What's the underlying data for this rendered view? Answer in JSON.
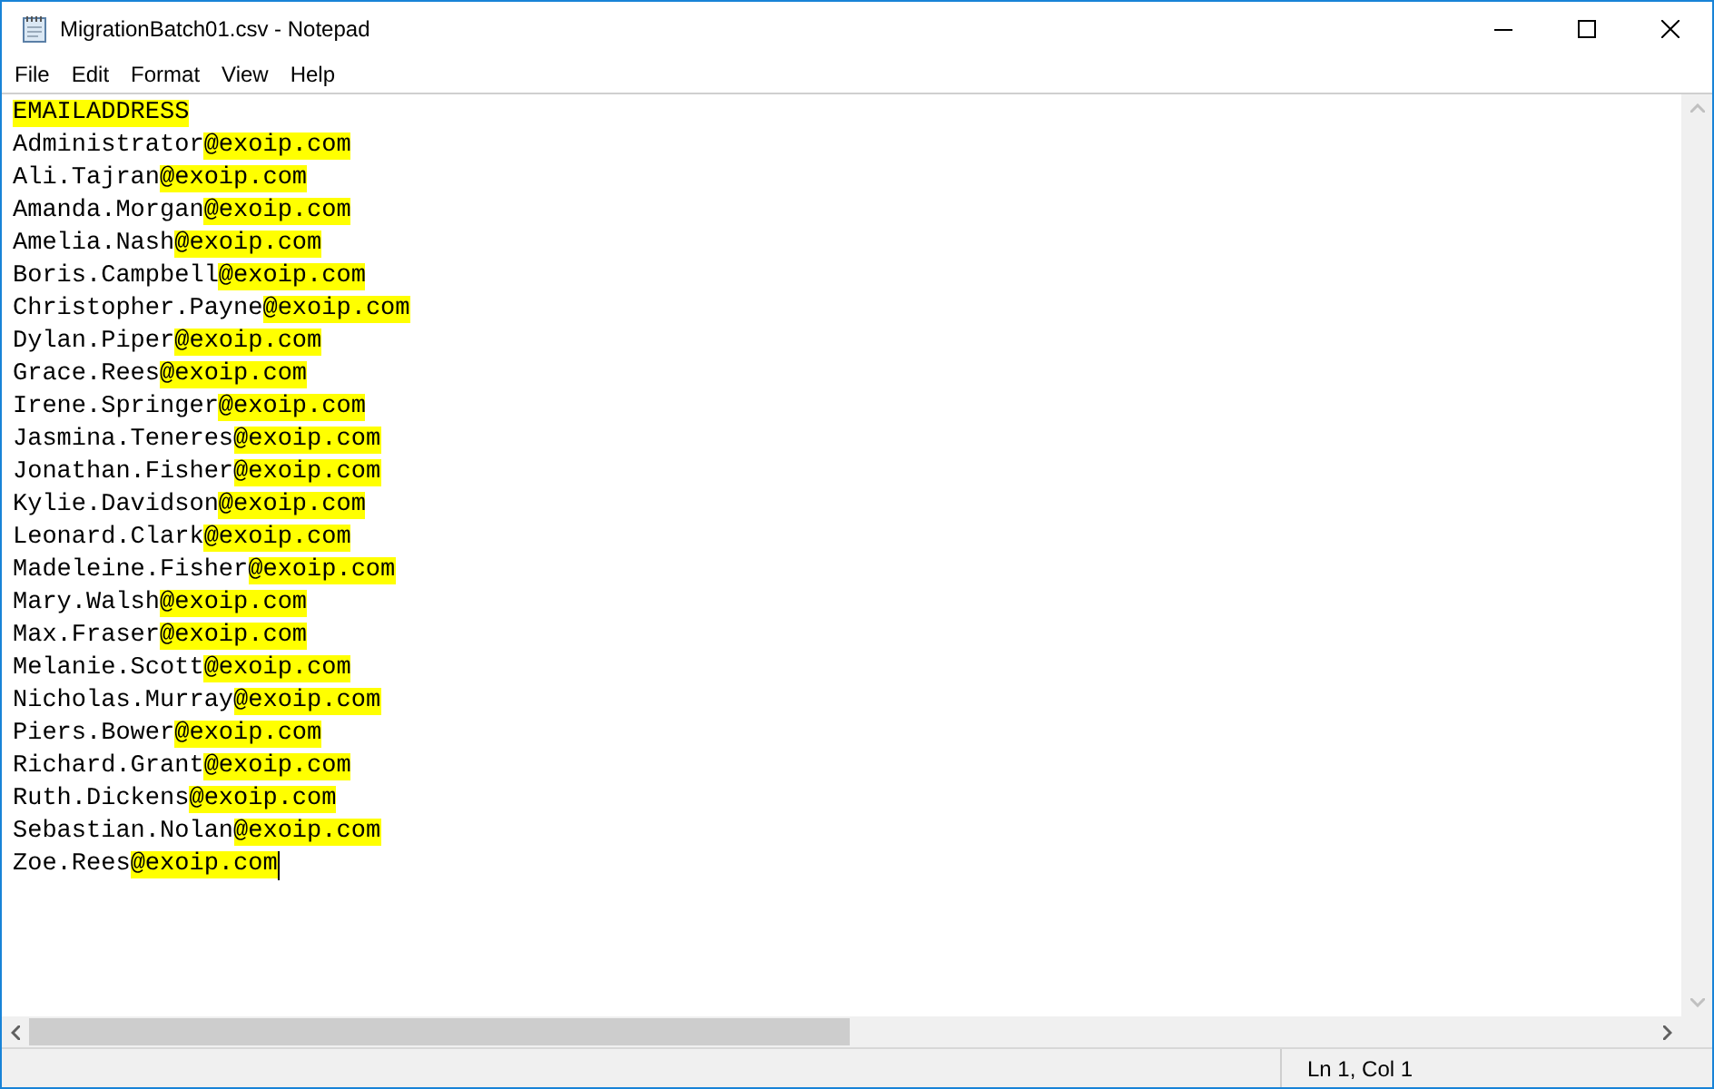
{
  "window": {
    "title": "MigrationBatch01.csv - Notepad"
  },
  "menu": [
    "File",
    "Edit",
    "Format",
    "View",
    "Help"
  ],
  "editor": {
    "lines": [
      {
        "segments": [
          {
            "text": "EMAILADDRESS",
            "highlighted": true
          }
        ]
      },
      {
        "segments": [
          {
            "text": "Administrator",
            "highlighted": false
          },
          {
            "text": "@exoip.com",
            "highlighted": true
          }
        ]
      },
      {
        "segments": [
          {
            "text": "Ali.Tajran",
            "highlighted": false
          },
          {
            "text": "@exoip.com",
            "highlighted": true
          }
        ]
      },
      {
        "segments": [
          {
            "text": "Amanda.Morgan",
            "highlighted": false
          },
          {
            "text": "@exoip.com",
            "highlighted": true
          }
        ]
      },
      {
        "segments": [
          {
            "text": "Amelia.Nash",
            "highlighted": false
          },
          {
            "text": "@exoip.com",
            "highlighted": true
          }
        ]
      },
      {
        "segments": [
          {
            "text": "Boris.Campbell",
            "highlighted": false
          },
          {
            "text": "@exoip.com",
            "highlighted": true
          }
        ]
      },
      {
        "segments": [
          {
            "text": "Christopher.Payne",
            "highlighted": false
          },
          {
            "text": "@exoip.com",
            "highlighted": true
          }
        ]
      },
      {
        "segments": [
          {
            "text": "Dylan.Piper",
            "highlighted": false
          },
          {
            "text": "@exoip.com",
            "highlighted": true
          }
        ]
      },
      {
        "segments": [
          {
            "text": "Grace.Rees",
            "highlighted": false
          },
          {
            "text": "@exoip.com",
            "highlighted": true
          }
        ]
      },
      {
        "segments": [
          {
            "text": "Irene.Springer",
            "highlighted": false
          },
          {
            "text": "@exoip.com",
            "highlighted": true
          }
        ]
      },
      {
        "segments": [
          {
            "text": "Jasmina.Teneres",
            "highlighted": false
          },
          {
            "text": "@exoip.com",
            "highlighted": true
          }
        ]
      },
      {
        "segments": [
          {
            "text": "Jonathan.Fisher",
            "highlighted": false
          },
          {
            "text": "@exoip.com",
            "highlighted": true
          }
        ]
      },
      {
        "segments": [
          {
            "text": "Kylie.Davidson",
            "highlighted": false
          },
          {
            "text": "@exoip.com",
            "highlighted": true
          }
        ]
      },
      {
        "segments": [
          {
            "text": "Leonard.Clark",
            "highlighted": false
          },
          {
            "text": "@exoip.com",
            "highlighted": true
          }
        ]
      },
      {
        "segments": [
          {
            "text": "Madeleine.Fisher",
            "highlighted": false
          },
          {
            "text": "@exoip.com",
            "highlighted": true
          }
        ]
      },
      {
        "segments": [
          {
            "text": "Mary.Walsh",
            "highlighted": false
          },
          {
            "text": "@exoip.com",
            "highlighted": true
          }
        ]
      },
      {
        "segments": [
          {
            "text": "Max.Fraser",
            "highlighted": false
          },
          {
            "text": "@exoip.com",
            "highlighted": true
          }
        ]
      },
      {
        "segments": [
          {
            "text": "Melanie.Scott",
            "highlighted": false
          },
          {
            "text": "@exoip.com",
            "highlighted": true
          }
        ]
      },
      {
        "segments": [
          {
            "text": "Nicholas.Murray",
            "highlighted": false
          },
          {
            "text": "@exoip.com",
            "highlighted": true
          }
        ]
      },
      {
        "segments": [
          {
            "text": "Piers.Bower",
            "highlighted": false
          },
          {
            "text": "@exoip.com",
            "highlighted": true
          }
        ]
      },
      {
        "segments": [
          {
            "text": "Richard.Grant",
            "highlighted": false
          },
          {
            "text": "@exoip.com",
            "highlighted": true
          }
        ]
      },
      {
        "segments": [
          {
            "text": "Ruth.Dickens",
            "highlighted": false
          },
          {
            "text": "@exoip.com",
            "highlighted": true
          }
        ]
      },
      {
        "segments": [
          {
            "text": "Sebastian.Nolan",
            "highlighted": false
          },
          {
            "text": "@exoip.com",
            "highlighted": true
          }
        ]
      },
      {
        "segments": [
          {
            "text": "Zoe.Rees",
            "highlighted": false
          },
          {
            "text": "@exoip.com",
            "highlighted": true
          }
        ]
      }
    ]
  },
  "status_bar": {
    "position": "Ln 1, Col 1"
  }
}
